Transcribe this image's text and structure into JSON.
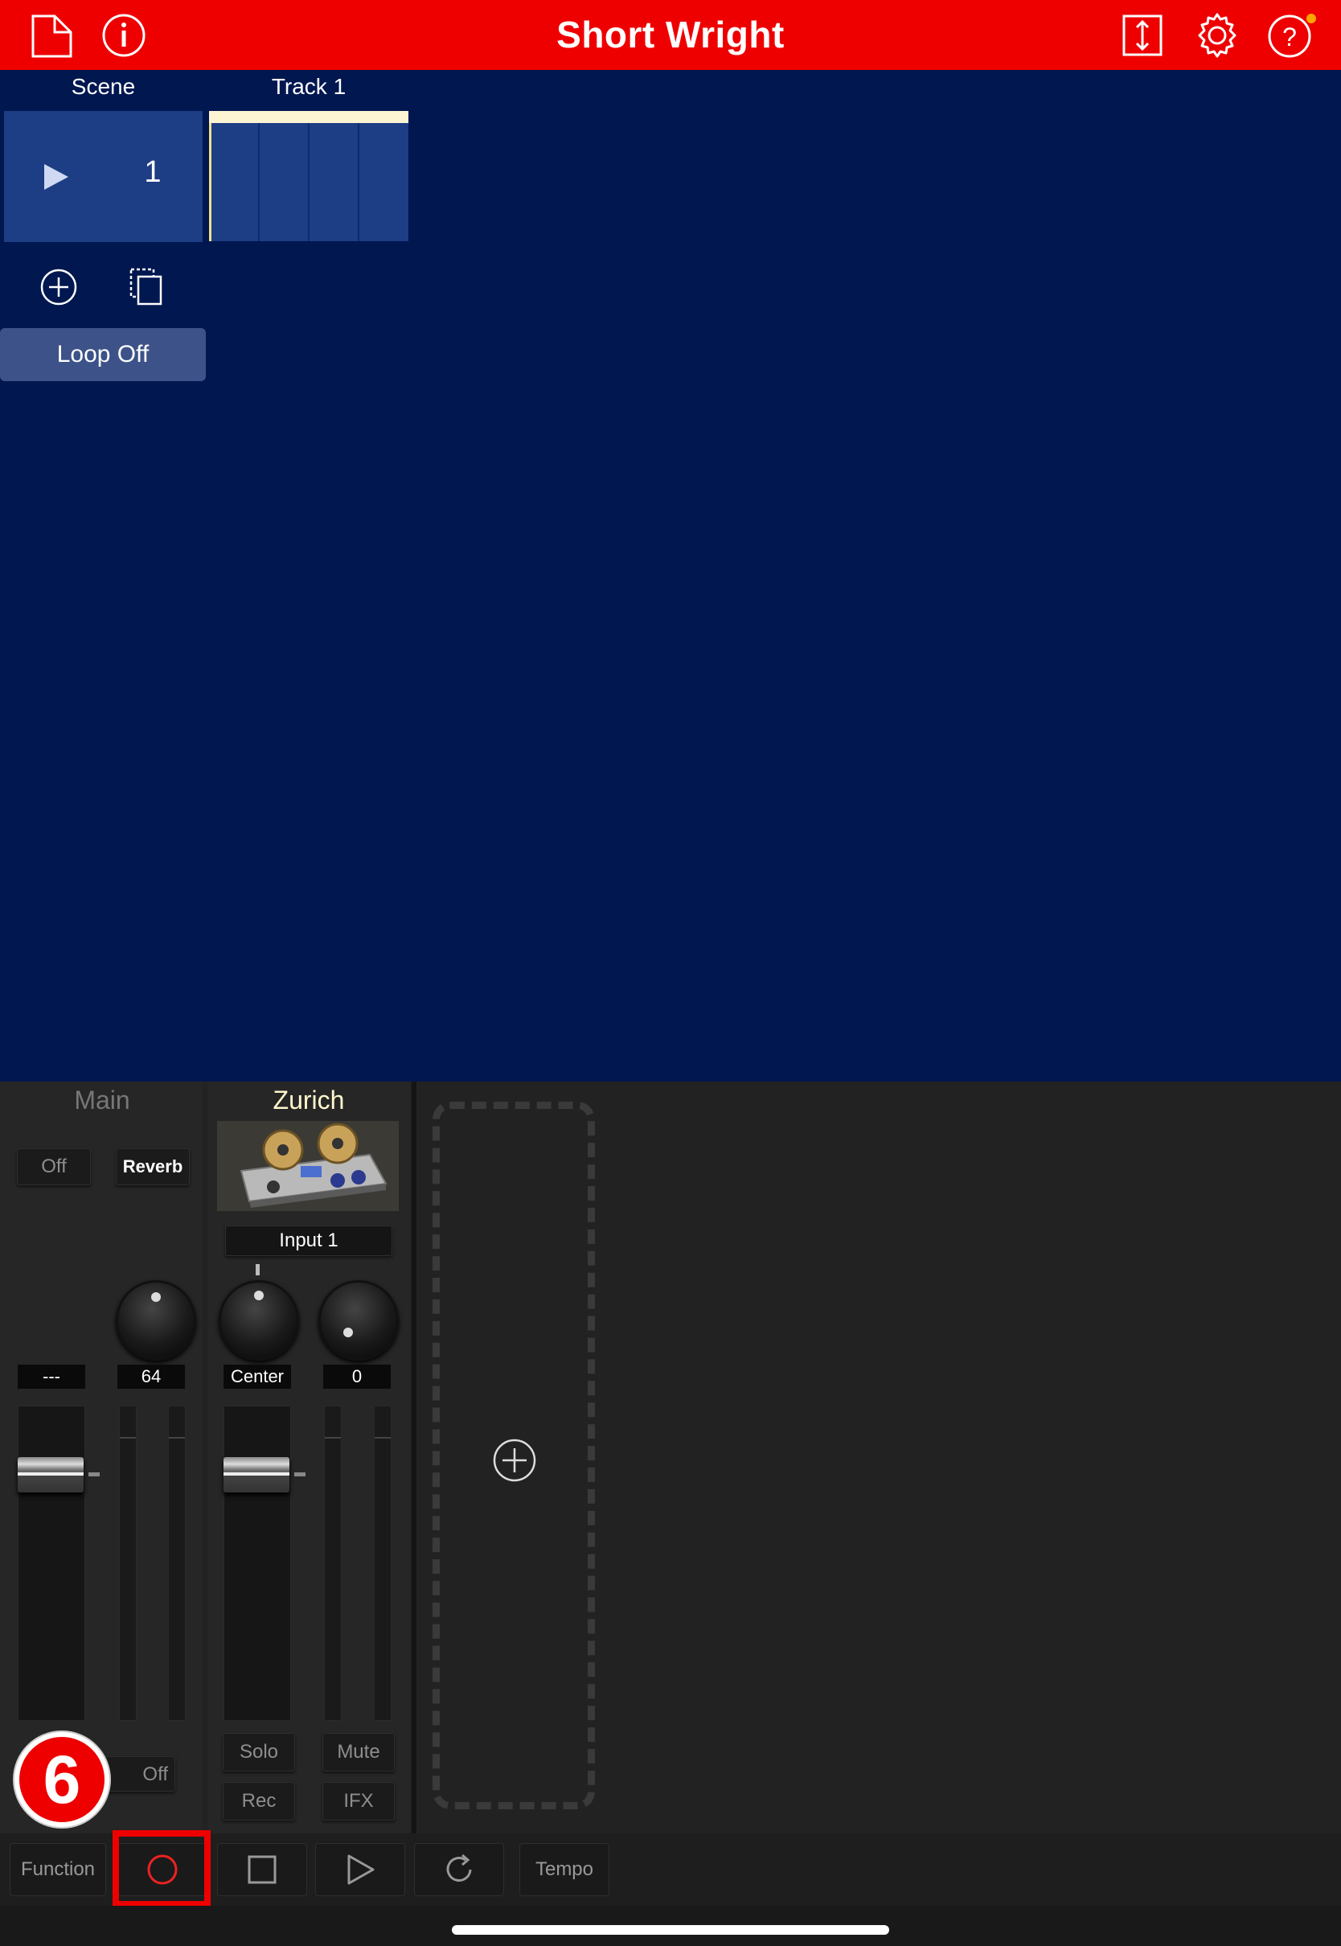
{
  "header": {
    "title": "Short Wright",
    "color": "#ee0000",
    "icons": [
      "new-document-icon",
      "info-icon",
      "resize-vertical-icon",
      "gear-icon",
      "help-icon"
    ],
    "help_badge_color": "#ffa500"
  },
  "scene": {
    "scene_header": "Scene",
    "track_header": "Track 1",
    "scene_number": "1",
    "loop_label": "Loop Off"
  },
  "mixer": {
    "main": {
      "name": "Main",
      "off_label": "Off",
      "reverb_label": "Reverb",
      "value_left": "---",
      "value_right": "64",
      "bottom_label": "Off"
    },
    "zurich": {
      "name": "Zurich",
      "input_label": "Input 1",
      "pan_value": "Center",
      "knob_value": "0",
      "solo_label": "Solo",
      "mute_label": "Mute",
      "rec_label": "Rec",
      "ifx_label": "IFX"
    }
  },
  "annotation": {
    "step_number": "6",
    "highlight_color": "#ee0000"
  },
  "transport": {
    "function_label": "Function",
    "tempo_label": "Tempo",
    "record_icon": "record-icon",
    "stop_icon": "stop-icon",
    "play_icon": "play-icon",
    "loop_icon": "loop-icon"
  }
}
